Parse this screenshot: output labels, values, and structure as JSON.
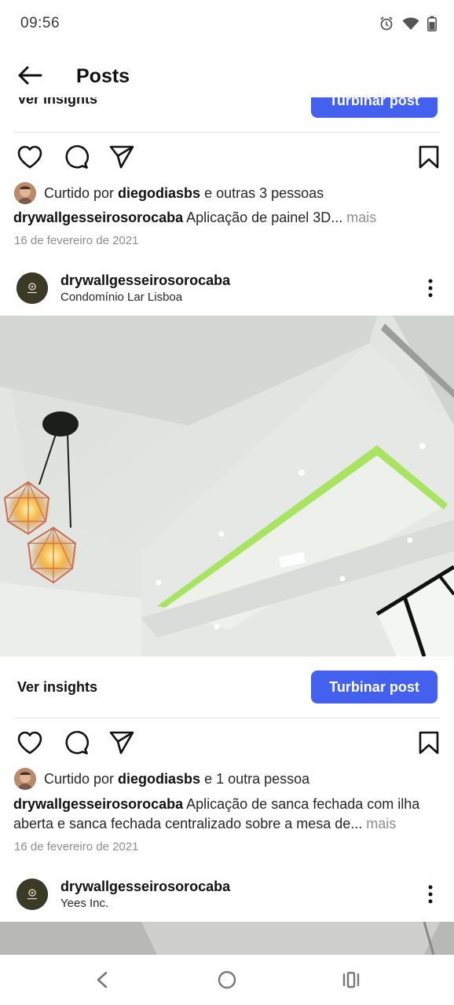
{
  "status_bar": {
    "time": "09:56",
    "icons": [
      "alarm-icon",
      "wifi-icon",
      "battery-icon"
    ]
  },
  "header": {
    "back_icon": "arrow-left-icon",
    "title": "Posts"
  },
  "peek": {
    "insights_label": "Ver insights",
    "boost_label": "Turbinar post"
  },
  "post1": {
    "likes_prefix": "Curtido por ",
    "likes_user": "diegodiasbs",
    "likes_suffix": " e outras 3 pessoas",
    "caption_user": "drywallgesseirosorocaba",
    "caption_text": "Aplicação de painel 3D...",
    "more_label": "mais",
    "date": "16 de fevereiro de 2021"
  },
  "post2": {
    "username": "drywallgesseirosorocaba",
    "location": "Condomínio Lar Lisboa",
    "insights_label": "Ver insights",
    "boost_label": "Turbinar post",
    "likes_prefix": "Curtido por ",
    "likes_user": "diegodiasbs",
    "likes_suffix": " e 1 outra pessoa",
    "caption_user": "drywallgesseirosorocaba",
    "caption_text": "Aplicação de sanca fechada com ilha aberta e sanca fechada centralizado sobre a mesa de...",
    "more_label": "mais",
    "date": "16 de fevereiro de 2021"
  },
  "post3": {
    "username": "drywallgesseirosorocaba",
    "location": "Yees Inc."
  },
  "colors": {
    "accent": "#4361ee",
    "text": "#262626",
    "muted": "#8e8e8e",
    "led_green": "#9be04a"
  }
}
